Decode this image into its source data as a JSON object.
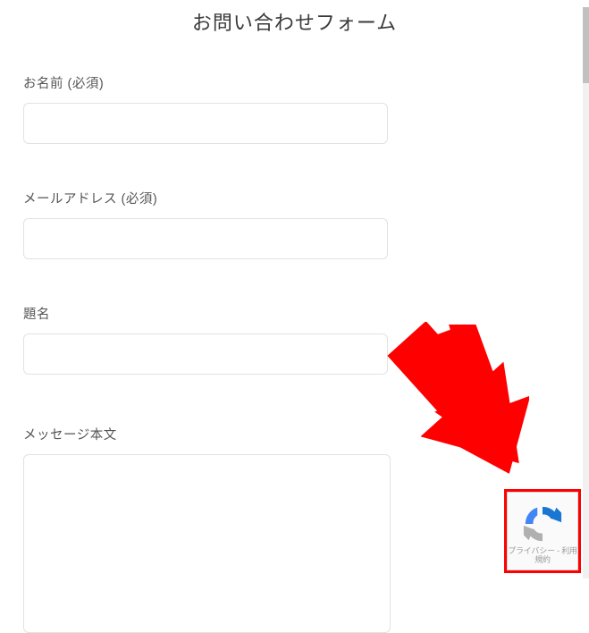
{
  "form": {
    "title": "お問い合わせフォーム",
    "fields": {
      "name": {
        "label": "お名前 (必須)",
        "value": ""
      },
      "email": {
        "label": "メールアドレス (必須)",
        "value": ""
      },
      "subject": {
        "label": "題名",
        "value": ""
      },
      "message": {
        "label": "メッセージ本文",
        "value": ""
      }
    }
  },
  "recaptcha": {
    "footer_text": "プライバシー - 利用規約"
  },
  "annotation": {
    "arrow_color": "#ff0000",
    "highlight_color": "#ff0000"
  }
}
